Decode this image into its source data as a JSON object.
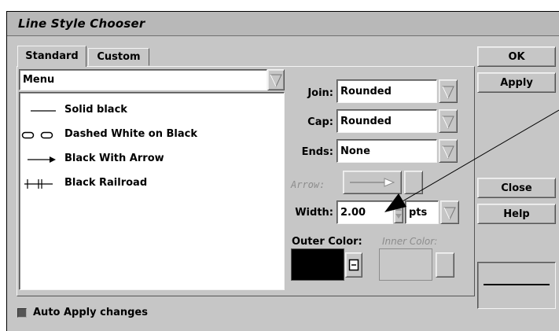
{
  "window": {
    "title": "Line Style Chooser"
  },
  "tabs": [
    {
      "label": "Standard"
    },
    {
      "label": "Custom"
    }
  ],
  "menu_select": {
    "value": "Menu"
  },
  "line_styles": [
    {
      "label": "Solid black",
      "icon": "solid-line-icon"
    },
    {
      "label": "Dashed White on Black",
      "icon": "dashed-line-icon"
    },
    {
      "label": "Black With Arrow",
      "icon": "arrow-line-icon"
    },
    {
      "label": "Black Railroad",
      "icon": "railroad-line-icon"
    }
  ],
  "properties": {
    "join": {
      "label": "Join:",
      "value": "Rounded"
    },
    "cap": {
      "label": "Cap:",
      "value": "Rounded"
    },
    "ends": {
      "label": "Ends:",
      "value": "None"
    },
    "arrow": {
      "label": "Arrow:"
    },
    "width": {
      "label": "Width:",
      "value": "2.00",
      "unit": "pts"
    },
    "outer_color": {
      "label": "Outer Color:",
      "color": "#000000"
    },
    "inner_color": {
      "label": "Inner Color:"
    }
  },
  "buttons": {
    "ok": "OK",
    "apply": "Apply",
    "close": "Close",
    "help": "Help"
  },
  "auto_apply": {
    "label": "Auto Apply changes",
    "checked": true
  }
}
